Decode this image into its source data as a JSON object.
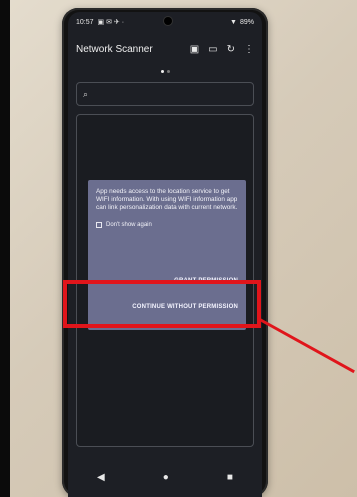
{
  "status_bar": {
    "time": "10:57",
    "left_icons": "▣ ✉ ✈ ·",
    "wifi_icon": "▼",
    "battery": "89%"
  },
  "app_bar": {
    "title": "Network Scanner",
    "actions": {
      "save_icon": "▣",
      "folder_icon": "▭",
      "refresh_icon": "↻",
      "more_icon": "⋮"
    }
  },
  "search": {
    "icon": "⌕",
    "value": "",
    "placeholder": ""
  },
  "dialog": {
    "message": "App needs access to the location service to get WIFI information. With using WIFI information app can link personalization data with current network.",
    "checkbox_label": "Don't show again",
    "grant_button": "GRANT PERMISSION",
    "continue_button": "CONTINUE WITHOUT PERMISSION"
  },
  "nav": {
    "back": "◀",
    "home": "●",
    "recents": "■"
  },
  "colors": {
    "highlight": "#e0151b",
    "dialog_bg": "#6b6e8f"
  }
}
